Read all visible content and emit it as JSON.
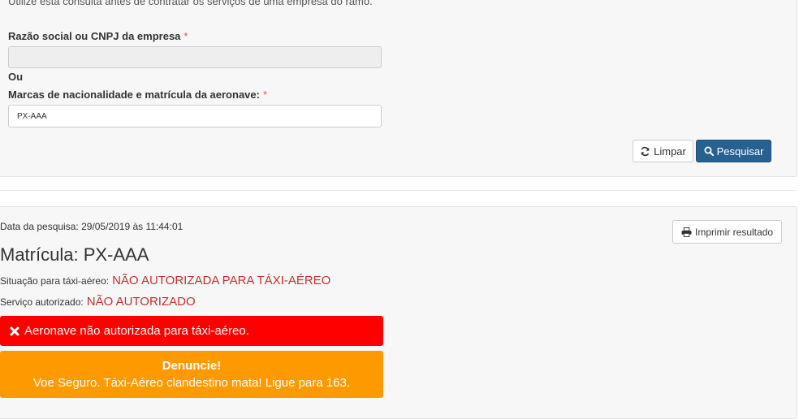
{
  "form": {
    "intro": "Utilize esta consulta antes de contratar os serviços de uma empresa do ramo.",
    "company_label": "Razão social ou CNPJ da empresa",
    "required_mark": "*",
    "company_value": "",
    "or_label": "Ou",
    "aircraft_label": "Marcas de nacionalidade e matrícula da aeronave:",
    "aircraft_value": "PX-AAA",
    "clear_button": "Limpar",
    "search_button": "Pesquisar"
  },
  "result": {
    "date": "Data da pesquisa: 29/05/2019 às 11:44:01",
    "print_button": "Imprimir resultado",
    "matricula": "Matrícula: PX-AAA",
    "situacao_label": "Situação para táxi-aéreo:",
    "situacao_value": "NÃO AUTORIZADA PARA TÁXI-AÉREO",
    "servico_label": "Serviço autorizado:",
    "servico_value": "NÃO AUTORIZADO",
    "alert_error": "Aeronave não autorizada para táxi-aéreo.",
    "alert_title": "Denuncie!",
    "alert_text": "Voe Seguro. Táxi-Aéreo clandestino mata! Ligue para 163."
  },
  "icons": {
    "refresh": "refresh-icon",
    "search": "search-icon",
    "print": "print-icon",
    "error": "close-icon"
  },
  "colors": {
    "primary": "#286090",
    "danger_text": "#c9302c",
    "alert_red": "#ff0000",
    "alert_orange": "#ff9900"
  }
}
